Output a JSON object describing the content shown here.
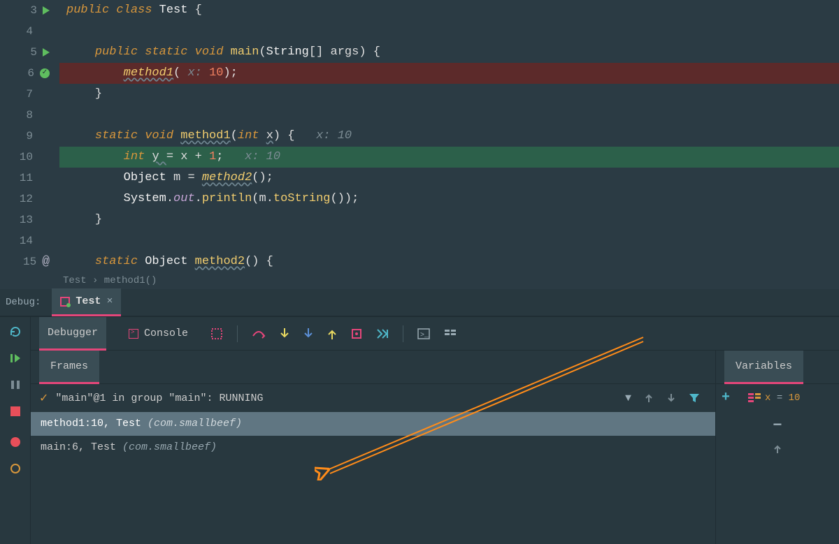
{
  "editor": {
    "lines": [
      {
        "num": 3,
        "icon": "run",
        "segments": [
          {
            "t": "public ",
            "c": "kw"
          },
          {
            "t": "class ",
            "c": "kw"
          },
          {
            "t": "Test ",
            "c": "cls"
          },
          {
            "t": "{",
            "c": "brace"
          }
        ],
        "indent": 0
      },
      {
        "num": 4,
        "segments": [],
        "indent": 0
      },
      {
        "num": 5,
        "icon": "run",
        "segments": [
          {
            "t": "public static ",
            "c": "kw"
          },
          {
            "t": "void ",
            "c": "type"
          },
          {
            "t": "main",
            "c": "call"
          },
          {
            "t": "(",
            "c": "paren"
          },
          {
            "t": "String",
            "c": "cls"
          },
          {
            "t": "[] ",
            "c": "paren"
          },
          {
            "t": "args",
            "c": "var"
          },
          {
            "t": ") {",
            "c": "paren"
          }
        ],
        "indent": 1
      },
      {
        "num": 6,
        "icon": "check",
        "highlight": "breakpoint-hit",
        "segments": [
          {
            "t": "method1",
            "c": "method2"
          },
          {
            "t": "( ",
            "c": "paren"
          },
          {
            "t": "x: ",
            "c": "param"
          },
          {
            "t": "10",
            "c": "num"
          },
          {
            "t": ");",
            "c": "paren"
          }
        ],
        "indent": 2
      },
      {
        "num": 7,
        "segments": [
          {
            "t": "}",
            "c": "brace"
          }
        ],
        "indent": 1
      },
      {
        "num": 8,
        "segments": [],
        "indent": 0
      },
      {
        "num": 9,
        "segments": [
          {
            "t": "static ",
            "c": "kw"
          },
          {
            "t": "void ",
            "c": "type"
          },
          {
            "t": "method1",
            "c": "method"
          },
          {
            "t": "(",
            "c": "paren"
          },
          {
            "t": "int ",
            "c": "type"
          },
          {
            "t": "x",
            "c": "var-x"
          },
          {
            "t": ") {   ",
            "c": "paren"
          },
          {
            "t": "x: 10",
            "c": "hint"
          }
        ],
        "indent": 1
      },
      {
        "num": 10,
        "highlight": "exec-line",
        "segments": [
          {
            "t": "int ",
            "c": "type"
          },
          {
            "t": "y ",
            "c": "var-x"
          },
          {
            "t": "= ",
            "c": "op"
          },
          {
            "t": "x ",
            "c": "var"
          },
          {
            "t": "+ ",
            "c": "op"
          },
          {
            "t": "1",
            "c": "num"
          },
          {
            "t": ";   ",
            "c": "paren"
          },
          {
            "t": "x: 10",
            "c": "hint"
          }
        ],
        "indent": 2
      },
      {
        "num": 11,
        "segments": [
          {
            "t": "Object ",
            "c": "cls"
          },
          {
            "t": "m ",
            "c": "var"
          },
          {
            "t": "= ",
            "c": "op"
          },
          {
            "t": "method2",
            "c": "method2"
          },
          {
            "t": "();",
            "c": "paren"
          }
        ],
        "indent": 2
      },
      {
        "num": 12,
        "segments": [
          {
            "t": "System",
            "c": "cls"
          },
          {
            "t": ".",
            "c": "op"
          },
          {
            "t": "out",
            "c": "out"
          },
          {
            "t": ".",
            "c": "op"
          },
          {
            "t": "println",
            "c": "call"
          },
          {
            "t": "(",
            "c": "paren"
          },
          {
            "t": "m",
            "c": "var"
          },
          {
            "t": ".",
            "c": "op"
          },
          {
            "t": "toString",
            "c": "call"
          },
          {
            "t": "());",
            "c": "paren"
          }
        ],
        "indent": 2
      },
      {
        "num": 13,
        "segments": [
          {
            "t": "}",
            "c": "brace"
          }
        ],
        "indent": 1
      },
      {
        "num": 14,
        "segments": [],
        "indent": 0
      },
      {
        "num": 15,
        "icon": "at",
        "segments": [
          {
            "t": "static ",
            "c": "kw"
          },
          {
            "t": "Object ",
            "c": "cls"
          },
          {
            "t": "method2",
            "c": "method"
          },
          {
            "t": "() {",
            "c": "paren"
          }
        ],
        "indent": 1
      }
    ],
    "breadcrumb": "Test › method1()"
  },
  "debug": {
    "label": "Debug:",
    "tab_title": "Test",
    "tabs": {
      "debugger": "Debugger",
      "console": "Console"
    },
    "frames_label": "Frames",
    "variables_label": "Variables",
    "thread_status": "\"main\"@1 in group \"main\": RUNNING",
    "frames": [
      {
        "text": "method1:10, Test ",
        "detail": "(com.smallbeef)",
        "selected": true
      },
      {
        "text": "main:6, Test ",
        "detail": "(com.smallbeef)",
        "selected": false
      }
    ],
    "variable": {
      "name": "x",
      "value": "10"
    }
  }
}
